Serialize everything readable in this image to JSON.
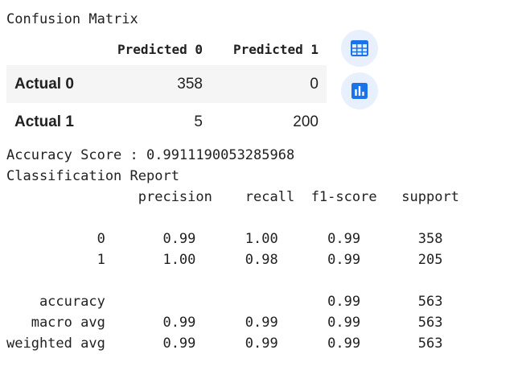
{
  "cm_title": "Confusion Matrix",
  "table": {
    "columns": [
      "Predicted 0",
      "Predicted 1"
    ],
    "rows": [
      {
        "label": "Actual 0",
        "values": [
          "358",
          "0"
        ]
      },
      {
        "label": "Actual 1",
        "values": [
          "5",
          "200"
        ]
      }
    ]
  },
  "actions": {
    "table_icon": "table-view-icon",
    "chart_icon": "bar-chart-icon"
  },
  "accuracy_line": "Accuracy Score : 0.9911190053285968",
  "report_title": "Classification Report",
  "report_text": "                precision    recall  f1-score   support\n\n           0       0.99      1.00      0.99       358\n           1       1.00      0.98      0.99       205\n\n    accuracy                           0.99       563\n   macro avg       0.99      0.99      0.99       563\nweighted avg       0.99      0.99      0.99       563",
  "colors": {
    "accent": "#1a73e8",
    "icon_bg": "#e8f0fe",
    "row_stripe": "#f5f5f5"
  }
}
